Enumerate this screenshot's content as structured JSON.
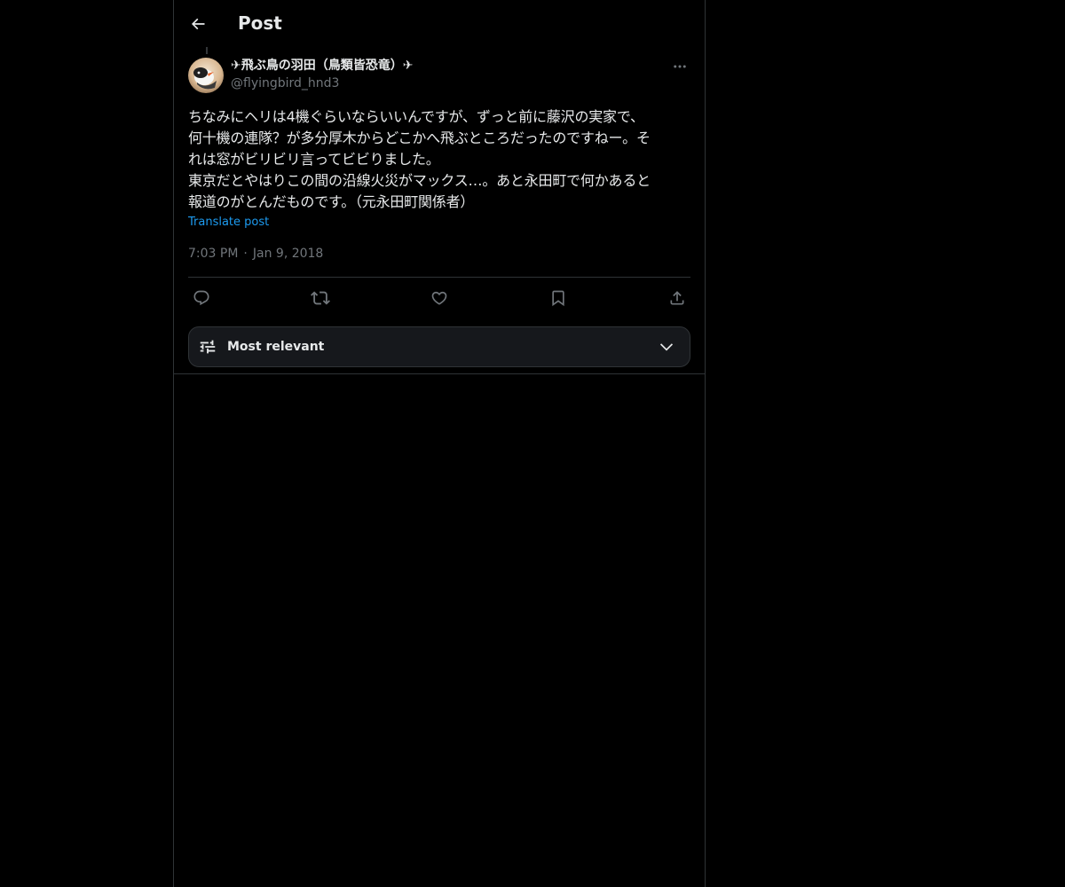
{
  "header": {
    "title": "Post",
    "back_icon": "arrow-left-icon"
  },
  "post": {
    "author": {
      "display_name": "✈飛ぶ鳥の羽田（鳥類皆恐竜）✈",
      "handle": "@flyingbird_hnd3",
      "avatar": "bird-avatar"
    },
    "text": "ちなみにヘリは4機ぐらいならいいんですが、ずっと前に藤沢の実家で、\n何十機の連隊？が多分厚木からどこかへ飛ぶところだったのですねー。そ\nれは窓がビリビリ言ってビビりました。\n東京だとやはりこの間の沿線火災がマックス…。あと永田町で何かあると\n報道のがとんだものです。（元永田町関係者）",
    "translate_label": "Translate post",
    "time": "7:03 PM",
    "separator": "·",
    "date": "Jan 9, 2018",
    "more_icon": "more-horizontal-icon"
  },
  "actions": [
    {
      "name": "reply",
      "icon": "reply-icon"
    },
    {
      "name": "repost",
      "icon": "repost-icon"
    },
    {
      "name": "like",
      "icon": "heart-icon"
    },
    {
      "name": "bookmark",
      "icon": "bookmark-icon"
    },
    {
      "name": "share",
      "icon": "share-icon"
    }
  ],
  "replies_sort": {
    "label": "Most relevant",
    "icon": "sliders-icon",
    "chevron": "chevron-down-icon"
  },
  "colors": {
    "background": "#000000",
    "text": "#e7e9ea",
    "muted": "#71767b",
    "link": "#1d9bf0",
    "border": "#2f3336"
  }
}
